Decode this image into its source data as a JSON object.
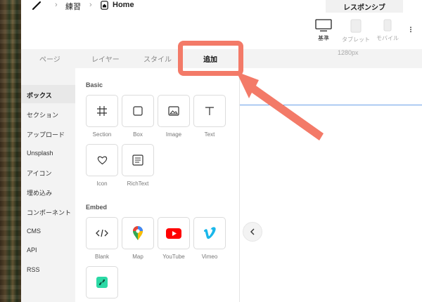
{
  "breadcrumb": {
    "project": "練習",
    "page": "Home"
  },
  "responsive_tab": "レスポンシブ",
  "devices": [
    {
      "label": "基準",
      "icon": "desktop-icon",
      "active": true
    },
    {
      "label": "タブレット",
      "icon": "tablet-icon",
      "active": false
    },
    {
      "label": "モバイル",
      "icon": "mobile-icon",
      "active": false
    }
  ],
  "tabs": [
    "ページ",
    "レイヤー",
    "スタイル",
    "追加"
  ],
  "active_tab": "追加",
  "canvas_width_label": "1280px",
  "categories": [
    "ボックス",
    "セクション",
    "アップロード",
    "Unsplash",
    "アイコン",
    "埋め込み",
    "コンポーネント",
    "CMS",
    "API",
    "RSS"
  ],
  "active_category": "ボックス",
  "sections": {
    "basic": {
      "title": "Basic",
      "items": [
        {
          "label": "Section",
          "icon": "section-icon"
        },
        {
          "label": "Box",
          "icon": "box-icon"
        },
        {
          "label": "Image",
          "icon": "image-icon"
        },
        {
          "label": "Text",
          "icon": "text-icon"
        },
        {
          "label": "Icon",
          "icon": "heart-icon"
        },
        {
          "label": "RichText",
          "icon": "richtext-icon"
        }
      ]
    },
    "embed": {
      "title": "Embed",
      "items": [
        {
          "label": "Blank",
          "icon": "code-icon"
        },
        {
          "label": "Map",
          "icon": "google-maps-icon"
        },
        {
          "label": "YouTube",
          "icon": "youtube-icon"
        },
        {
          "label": "Vimeo",
          "icon": "vimeo-icon"
        },
        {
          "label": "",
          "icon": "link-app-icon"
        }
      ]
    }
  },
  "colors": {
    "highlight": "#f37a68",
    "youtube": "#ff0000",
    "vimeo": "#1ab7ea",
    "teal": "#2bd9a5"
  }
}
